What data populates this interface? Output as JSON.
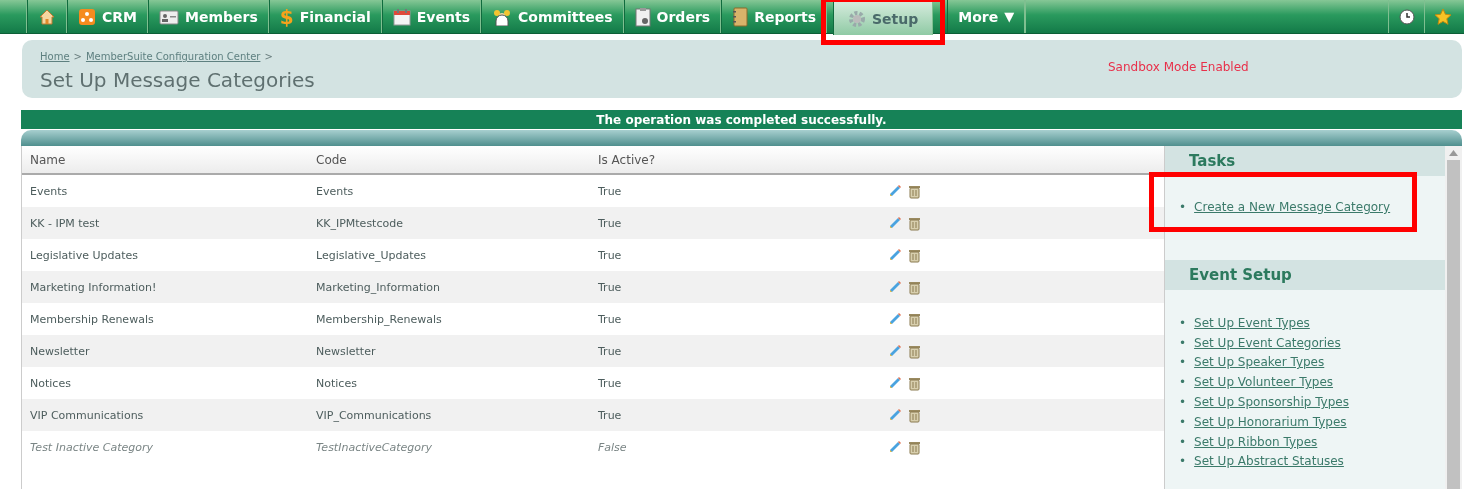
{
  "nav": {
    "tabs": [
      {
        "selected": false,
        "highlighted": false
      },
      {
        "label": "CRM",
        "selected": false,
        "highlighted": false
      },
      {
        "label": "Members",
        "selected": false,
        "highlighted": false
      },
      {
        "label": "Financial",
        "glyph": "$",
        "selected": false,
        "highlighted": false
      },
      {
        "label": "Events",
        "selected": false,
        "highlighted": false
      },
      {
        "label": "Committees",
        "selected": false,
        "highlighted": false
      },
      {
        "label": "Orders",
        "selected": false,
        "highlighted": false
      },
      {
        "label": "Reports",
        "selected": false,
        "highlighted": false
      },
      {
        "label": "Setup",
        "selected": true,
        "highlighted": true
      }
    ],
    "more": {
      "label": "More",
      "caret": "▼"
    }
  },
  "header": {
    "breadcrumb": [
      {
        "label": "Home"
      },
      {
        "label": "MemberSuite Configuration Center"
      }
    ],
    "separator": ">",
    "title": "Set Up Message Categories",
    "sandbox": "Sandbox Mode Enabled"
  },
  "message": "The operation was completed successfully.",
  "table": {
    "columns": [
      "Name",
      "Code",
      "Is Active?"
    ],
    "rows": [
      {
        "name": "Events",
        "code": "Events",
        "active": "True",
        "inactive": false
      },
      {
        "name": "KK - IPM test",
        "code": "KK_IPMtestcode",
        "active": "True",
        "inactive": false
      },
      {
        "name": "Legislative Updates",
        "code": "Legislative_Updates",
        "active": "True",
        "inactive": false
      },
      {
        "name": "Marketing Information!",
        "code": "Marketing_Information",
        "active": "True",
        "inactive": false
      },
      {
        "name": "Membership Renewals",
        "code": "Membership_Renewals",
        "active": "True",
        "inactive": false
      },
      {
        "name": "Newsletter",
        "code": "Newsletter",
        "active": "True",
        "inactive": false
      },
      {
        "name": "Notices",
        "code": "Notices",
        "active": "True",
        "inactive": false
      },
      {
        "name": "VIP Communications",
        "code": "VIP_Communications",
        "active": "True",
        "inactive": false
      },
      {
        "name": "Test Inactive Category",
        "code": "TestInactiveCategory",
        "active": "False",
        "inactive": true
      }
    ]
  },
  "bullet": "•",
  "sidebar": [
    {
      "title": "Tasks",
      "links": [
        {
          "label": "Create a New Message Category",
          "highlighted": true
        }
      ]
    },
    {
      "title": "Event Setup",
      "links": [
        {
          "label": "Set Up Event Types",
          "highlighted": false
        },
        {
          "label": "Set Up Event Categories",
          "highlighted": false
        },
        {
          "label": "Set Up Speaker Types",
          "highlighted": false
        },
        {
          "label": "Set Up Volunteer Types",
          "highlighted": false
        },
        {
          "label": "Set Up Sponsorship Types",
          "highlighted": false
        },
        {
          "label": "Set Up Honorarium Types",
          "highlighted": false
        },
        {
          "label": "Set Up Ribbon Types",
          "highlighted": false
        },
        {
          "label": "Set Up Abstract Statuses",
          "highlighted": false
        }
      ]
    }
  ]
}
